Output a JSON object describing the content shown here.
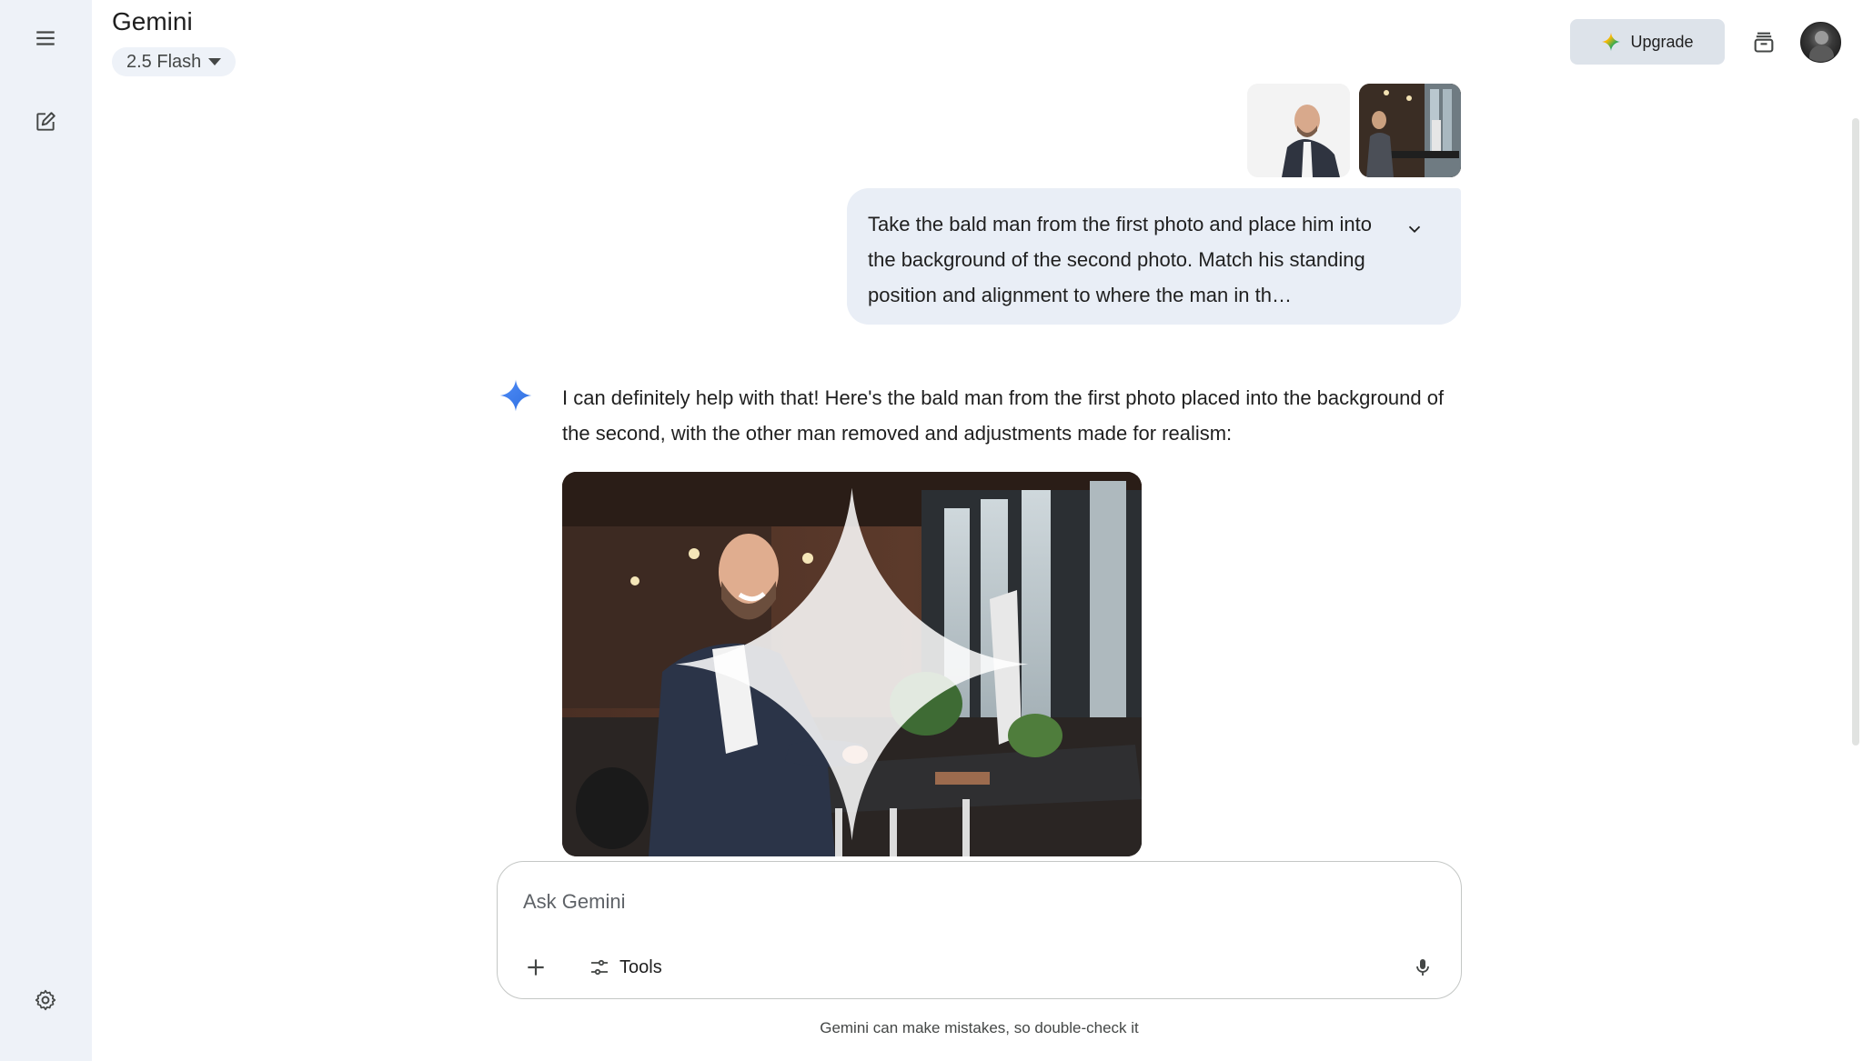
{
  "app": {
    "title": "Gemini"
  },
  "model_selector": {
    "label": "2.5 Flash"
  },
  "header": {
    "upgrade_label": "Upgrade"
  },
  "icons": {
    "menu": "menu-icon",
    "new_chat": "edit-icon",
    "settings": "gear-icon",
    "upgrade": "gemini-sparkle-icon",
    "history": "stack-icon",
    "expand": "chevron-down-icon",
    "response": "gemini-sparkle-icon",
    "add": "plus-icon",
    "tools": "tune-icon",
    "mic": "mic-icon"
  },
  "user_message": {
    "text": "Take the bald man from the first photo and place him into the background of the second photo. Match his standing position and alignment to where the man in th…",
    "attachments": [
      "portrait-photo",
      "office-photo"
    ]
  },
  "response": {
    "text": "I can definitely help with that! Here's the bald man from the first photo placed into the background of the second, with the other man removed and adjustments made for realism:"
  },
  "input": {
    "placeholder": "Ask Gemini",
    "value": "",
    "tools_label": "Tools"
  },
  "footer": {
    "disclaimer": "Gemini can make mistakes, so double-check it"
  },
  "colors": {
    "rail_bg": "#eef2f8",
    "bubble_bg": "#e9eef6",
    "upgrade_bg": "#dde3ea",
    "spark_blue": "#4285f4"
  }
}
